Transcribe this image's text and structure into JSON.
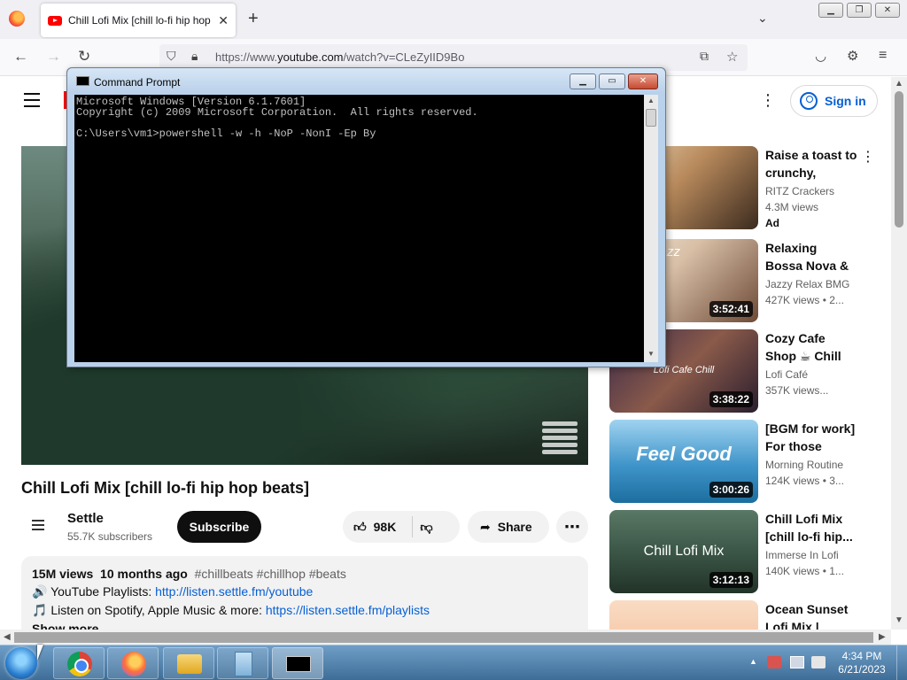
{
  "browser": {
    "tab_title": "Chill Lofi Mix [chill lo-fi hip hop beats]",
    "url_prefix": "https://www.",
    "url_domain": "youtube.com",
    "url_path": "/watch?v=CLeZyIID9Bo"
  },
  "youtube": {
    "signin_label": "Sign in",
    "video_title": "Chill Lofi Mix [chill lo-fi hip hop beats]",
    "channel": {
      "name": "Settle",
      "subscribers": "55.7K subscribers"
    },
    "subscribe_label": "Subscribe",
    "likes": "98K",
    "share_label": "Share",
    "description": {
      "views": "15M views",
      "age": "10 months ago",
      "hashtags": "#chillbeats #chillhop #beats",
      "line1_prefix": "🔊 YouTube Playlists: ",
      "line1_link": "http://listen.settle.fm/youtube",
      "line2_prefix": "🎵 Listen on Spotify, Apple Music & more: ",
      "line2_link": "https://listen.settle.fm/playlists",
      "more_label": "Show more"
    },
    "recommendations": [
      {
        "title": "Raise a toast to crunchy, toast...",
        "channel": "RITZ Crackers",
        "views": "4.3M views",
        "badge": "Ad",
        "duration": "",
        "caption": ""
      },
      {
        "title": "Relaxing Bossa Nova & Jazz...",
        "channel": "Jazzy Relax BMG",
        "views": "427K views • 2...",
        "badge": "",
        "duration": "3:52:41",
        "caption": "Nova Jazz"
      },
      {
        "title": "Cozy Cafe Shop ☕ Chill Lofi Hi...",
        "channel": "Lofi Café",
        "views": "357K views...",
        "badge": "",
        "duration": "3:38:22",
        "caption": "Lofi Cafe Chill"
      },
      {
        "title": "[BGM for work] For those who...",
        "channel": "Morning Routine",
        "views": "124K views • 3...",
        "badge": "",
        "duration": "3:00:26",
        "caption": "Feel Good"
      },
      {
        "title": "Chill Lofi Mix [chill lo-fi hip...",
        "channel": "Immerse In Lofi",
        "views": "140K views • 1...",
        "badge": "",
        "duration": "3:12:13",
        "caption": "Chill Lofi Mix"
      },
      {
        "title": "Ocean Sunset Lofi Mix |",
        "channel": "",
        "views": "",
        "badge": "",
        "duration": "",
        "caption": ""
      }
    ]
  },
  "cmd": {
    "title": "Command Prompt",
    "lines": [
      "Microsoft Windows [Version 6.1.7601]",
      "Copyright (c) 2009 Microsoft Corporation.  All rights reserved.",
      "",
      "C:\\Users\\vm1>powershell -w -h -NoP -NonI -Ep By"
    ]
  },
  "taskbar": {
    "time": "4:34 PM",
    "date": "6/21/2023"
  },
  "colors": {
    "youtube_red": "#ff0000",
    "link_blue": "#065fd4",
    "taskbar": "#4a7aa6"
  }
}
